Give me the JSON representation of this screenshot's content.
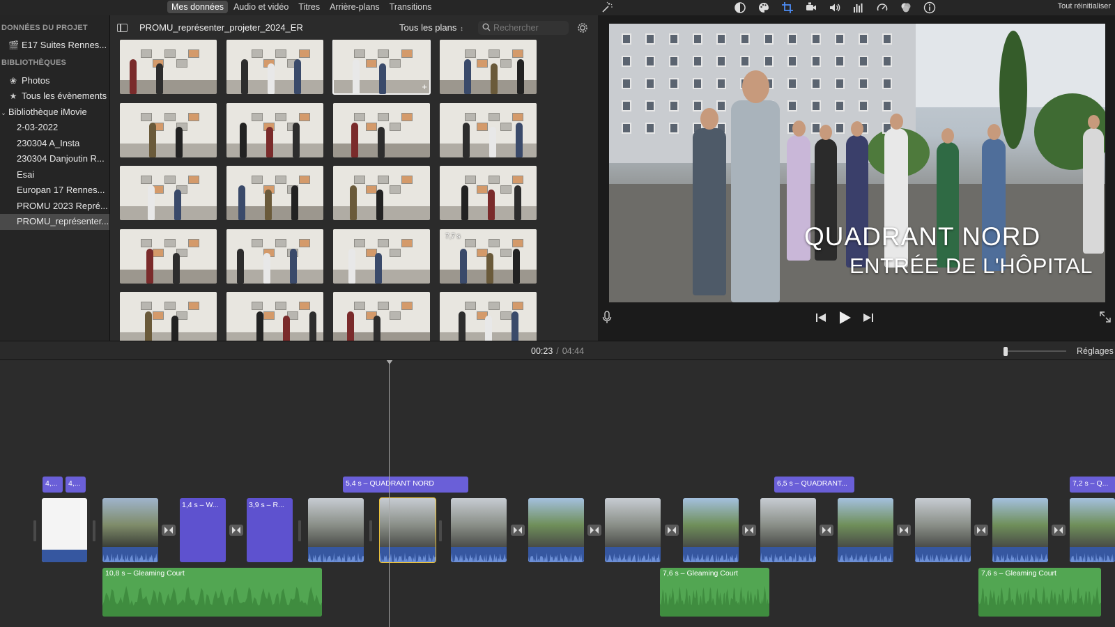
{
  "media_tabs": [
    "Mes données",
    "Audio et vidéo",
    "Titres",
    "Arrière-plans",
    "Transitions"
  ],
  "active_media_tab": "Mes données",
  "reset_all": "Tout réinitialiser",
  "toolbar_icons": [
    "color-balance-icon",
    "color-palette-icon",
    "crop-icon",
    "stabilization-icon",
    "volume-icon",
    "equalizer-icon",
    "speed-icon",
    "noise-reduction-icon",
    "info-icon"
  ],
  "sidebar": {
    "project_heading": "DONNÉES DU PROJET",
    "project_item": "E17 Suites Rennes...",
    "libraries_heading": "BIBLIOTHÈQUES",
    "photos": "Photos",
    "all_events": "Tous les évènements",
    "library": "Bibliothèque iMovie",
    "events": [
      "2-03-2022",
      "230304 A_Insta",
      "230304 Danjoutin R...",
      "Esai",
      "Europan 17 Rennes...",
      "PROMU 2023 Repré...",
      "PROMU_représenter..."
    ],
    "selected_event": "PROMU_représenter..."
  },
  "browser": {
    "project_name": "PROMU_représenter_projeter_2024_ER",
    "filter": "Tous les plans",
    "search_placeholder": "Rechercher",
    "thumb_duration_label": "7,7 s"
  },
  "viewer": {
    "title_line1": "QUADRANT NORD",
    "title_line2": "ENTRÉE DE L'HÔPITAL"
  },
  "timebar": {
    "current": "00:23",
    "separator": "/",
    "total": "04:44",
    "settings": "Réglages"
  },
  "timeline": {
    "title_clips": [
      "4,...",
      "4,...",
      "5,4 s – QUADRANT NORD",
      "6,5 s – QUADRANT...",
      "7,2 s – Q..."
    ],
    "violet_clips": [
      "1,4 s – W...",
      "3,9 s – R..."
    ],
    "music_clips": [
      "10,8 s – Gleaming Court",
      "7,6 s – Gleaming Court",
      "7,6 s – Gleaming Court"
    ]
  },
  "colors": {
    "title_clip": "#6a5fd8",
    "music_clip": "#52a652",
    "selection": "#f0c436",
    "audio_strip": "#3657a0"
  }
}
